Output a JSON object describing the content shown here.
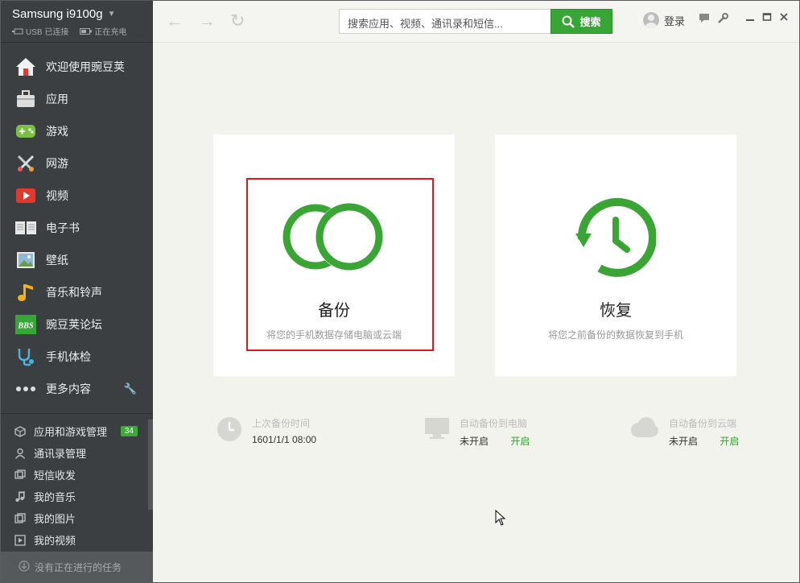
{
  "device": {
    "name": "Samsung i9100g",
    "usb_status": "USB 已连接",
    "charge_status": "正在充电"
  },
  "nav": [
    {
      "key": "welcome",
      "label": "欢迎使用豌豆荚",
      "icon": "home-icon"
    },
    {
      "key": "apps",
      "label": "应用",
      "icon": "bag-icon"
    },
    {
      "key": "games",
      "label": "游戏",
      "icon": "gamepad-icon"
    },
    {
      "key": "netgames",
      "label": "网游",
      "icon": "swords-icon"
    },
    {
      "key": "video",
      "label": "视频",
      "icon": "play-icon"
    },
    {
      "key": "ebook",
      "label": "电子书",
      "icon": "book-icon"
    },
    {
      "key": "wallpaper",
      "label": "壁纸",
      "icon": "picture-icon"
    },
    {
      "key": "music",
      "label": "音乐和铃声",
      "icon": "music-note-icon"
    },
    {
      "key": "forum",
      "label": "豌豆荚论坛",
      "icon": "bbs-icon",
      "icon_text": "BBS"
    },
    {
      "key": "checkup",
      "label": "手机体检",
      "icon": "stethoscope-icon"
    },
    {
      "key": "more",
      "label": "更多内容",
      "icon": "more-dots-icon"
    }
  ],
  "manage": [
    {
      "label": "应用和游戏管理",
      "badge": "34",
      "icon": "box-icon"
    },
    {
      "label": "通讯录管理",
      "icon": "person-icon"
    },
    {
      "label": "短信收发",
      "icon": "message-icon"
    },
    {
      "label": "我的音乐",
      "icon": "music-icon"
    },
    {
      "label": "我的图片",
      "icon": "image-icon"
    },
    {
      "label": "我的视频",
      "icon": "video-icon"
    }
  ],
  "tasks": {
    "label": "没有正在进行的任务"
  },
  "topbar": {
    "search_placeholder": "搜索应用、视频、通讯录和短信...",
    "search_button": "搜索",
    "login": "登录"
  },
  "cards": {
    "backup": {
      "title": "备份",
      "desc": "将您的手机数据存储电脑或云端"
    },
    "restore": {
      "title": "恢复",
      "desc": "将您之前备份的数据恢复到手机"
    }
  },
  "info": {
    "last_backup": {
      "label": "上次备份时间",
      "value": "1601/1/1 08:00"
    },
    "auto_pc": {
      "label": "自动备份到电脑",
      "value": "未开启",
      "action": "开启"
    },
    "auto_cloud": {
      "label": "自动备份到云端",
      "value": "未开启",
      "action": "开启"
    }
  },
  "colors": {
    "accent": "#38a537",
    "sidebar": "#3b3f42",
    "highlight": "#e0171c"
  }
}
